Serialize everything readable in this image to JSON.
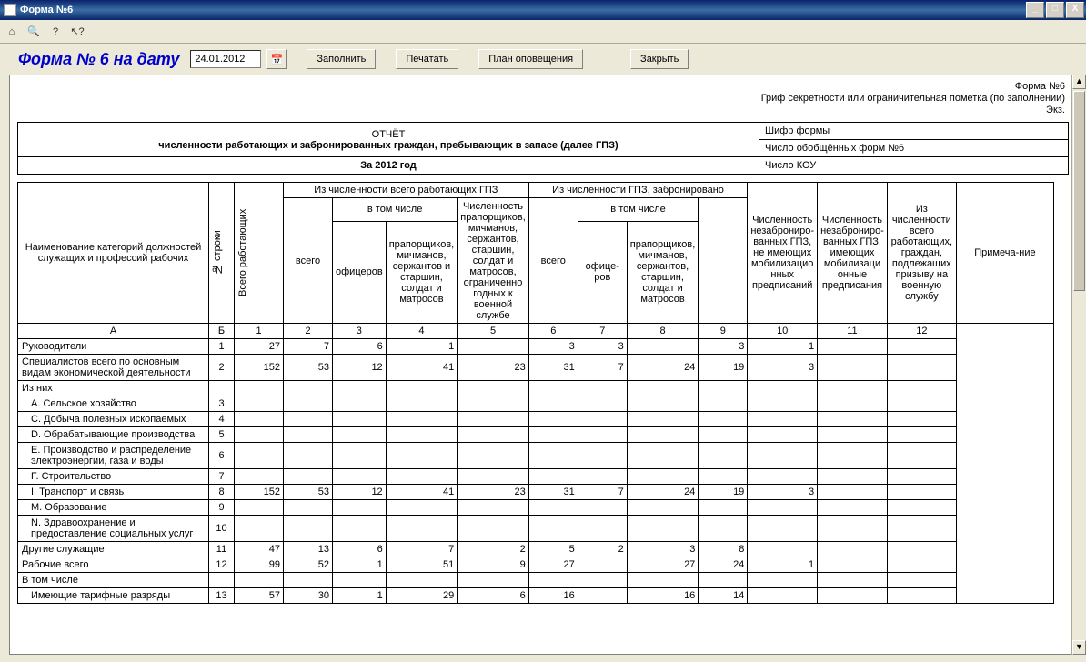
{
  "window": {
    "title": "Форма №6"
  },
  "header": {
    "form_title": "Форма № 6 на дату",
    "date_value": "24.01.2012",
    "btn_fill": "Заполнить",
    "btn_print": "Печатать",
    "btn_plan": "План оповещения",
    "btn_close": "Закрыть"
  },
  "meta": {
    "line1": "Форма №6",
    "line2": "Гриф секретности или ограничительная пометка (по заполнении)",
    "line3": "Экз."
  },
  "report_head": {
    "left": {
      "t1": "ОТЧЁТ",
      "t2": "численности работающих и забронированных граждан, пребывающих в запасе (далее ГПЗ)",
      "t3": "За 2012 год"
    },
    "right": {
      "r1": "Шифр формы",
      "r2": "Число обобщённых форм №6",
      "r3": "Число КОУ"
    }
  },
  "thead": {
    "col_a": "Наименование категорий должностей служащих и профессий рабочих",
    "col_b": "№ строки",
    "col_1": "Всего работающих",
    "grp1": "Из численности всего работающих ГПЗ",
    "grp1_sum": "всего",
    "grp1_sub": "в том числе",
    "c3": "офицеров",
    "c4": "прапорщиков, мичманов, сержантов и старшин, солдат и матросов",
    "c5": "Численность прапорщиков, мичманов, сержантов, старшин, солдат и матросов, ограниченно годных к военной службе",
    "grp2": "Из численности ГПЗ, забронировано",
    "grp2_sum": "всего",
    "grp2_sub": "в том числе",
    "c7": "офице-ров",
    "c8": "прапорщиков, мичманов, сержантов, старшин, солдат и матросов",
    "c9": "Численность незаброниро-ванных ГПЗ, не имеющих мобилизацио нных предписаний",
    "c10": "Численность незаброниро-ванных ГПЗ, имеющих мобилизаци онные предписания",
    "c11": "Из численности всего работающих, граждан, подлежащих призыву на военную службу",
    "c12": "Примеча-ние"
  },
  "colnums": {
    "a": "А",
    "b": "Б",
    "1": "1",
    "2": "2",
    "3": "3",
    "4": "4",
    "5": "5",
    "6": "6",
    "7": "7",
    "8": "8",
    "9": "9",
    "10": "10",
    "11": "11",
    "12": "12"
  },
  "rows": [
    {
      "label": "Руководители",
      "indent": 0,
      "n": "1",
      "v": [
        "27",
        "7",
        "6",
        "1",
        "",
        "3",
        "3",
        "",
        "3",
        "1",
        "",
        ""
      ]
    },
    {
      "label": "Специалистов всего по основным видам экономической деятельности",
      "indent": 0,
      "n": "2",
      "v": [
        "152",
        "53",
        "12",
        "41",
        "23",
        "31",
        "7",
        "24",
        "19",
        "3",
        "",
        ""
      ]
    },
    {
      "label": "Из них",
      "indent": 0,
      "n": "",
      "v": [
        "",
        "",
        "",
        "",
        "",
        "",
        "",
        "",
        "",
        "",
        "",
        ""
      ]
    },
    {
      "label": "A. Сельское хозяйство",
      "indent": 1,
      "n": "3",
      "v": [
        "",
        "",
        "",
        "",
        "",
        "",
        "",
        "",
        "",
        "",
        "",
        ""
      ]
    },
    {
      "label": "C. Добыча полезных ископаемых",
      "indent": 1,
      "n": "4",
      "v": [
        "",
        "",
        "",
        "",
        "",
        "",
        "",
        "",
        "",
        "",
        "",
        ""
      ]
    },
    {
      "label": "D. Обрабатывающие производства",
      "indent": 1,
      "n": "5",
      "v": [
        "",
        "",
        "",
        "",
        "",
        "",
        "",
        "",
        "",
        "",
        "",
        ""
      ]
    },
    {
      "label": "E. Производство и распределение электроэнергии, газа и воды",
      "indent": 1,
      "n": "6",
      "v": [
        "",
        "",
        "",
        "",
        "",
        "",
        "",
        "",
        "",
        "",
        "",
        ""
      ]
    },
    {
      "label": "F. Строительство",
      "indent": 1,
      "n": "7",
      "v": [
        "",
        "",
        "",
        "",
        "",
        "",
        "",
        "",
        "",
        "",
        "",
        ""
      ]
    },
    {
      "label": "I. Транспорт и связь",
      "indent": 1,
      "n": "8",
      "v": [
        "152",
        "53",
        "12",
        "41",
        "23",
        "31",
        "7",
        "24",
        "19",
        "3",
        "",
        ""
      ]
    },
    {
      "label": "M. Образование",
      "indent": 1,
      "n": "9",
      "v": [
        "",
        "",
        "",
        "",
        "",
        "",
        "",
        "",
        "",
        "",
        "",
        ""
      ]
    },
    {
      "label": "N. Здравоохранение и предоставление социальных услуг",
      "indent": 1,
      "n": "10",
      "v": [
        "",
        "",
        "",
        "",
        "",
        "",
        "",
        "",
        "",
        "",
        "",
        ""
      ]
    },
    {
      "label": "Другие служащие",
      "indent": 0,
      "n": "11",
      "v": [
        "47",
        "13",
        "6",
        "7",
        "2",
        "5",
        "2",
        "3",
        "8",
        "",
        "",
        " "
      ]
    },
    {
      "label": "Рабочие всего",
      "indent": 0,
      "n": "12",
      "v": [
        "99",
        "52",
        "1",
        "51",
        "9",
        "27",
        "",
        "27",
        "24",
        "1",
        "",
        ""
      ]
    },
    {
      "label": "В том числе",
      "indent": 0,
      "n": "",
      "v": [
        "",
        "",
        "",
        "",
        "",
        "",
        "",
        "",
        "",
        "",
        "",
        ""
      ]
    },
    {
      "label": "Имеющие тарифные разряды",
      "indent": 1,
      "n": "13",
      "v": [
        "57",
        "30",
        "1",
        "29",
        "6",
        "16",
        "",
        "16",
        "14",
        "",
        "",
        ""
      ]
    }
  ]
}
